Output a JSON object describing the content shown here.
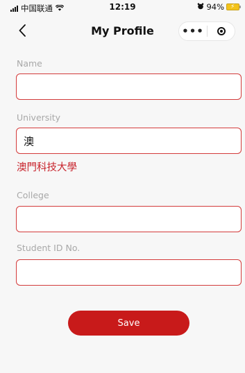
{
  "status_bar": {
    "carrier": "中国联通",
    "time": "12:19",
    "battery": "94%"
  },
  "nav": {
    "title": "My Profile",
    "more": "•••"
  },
  "form": {
    "name": {
      "label": "Name",
      "value": ""
    },
    "university": {
      "label": "University",
      "value": "澳",
      "suggestion": "澳門科技大學"
    },
    "college": {
      "label": "College",
      "value": ""
    },
    "student_id": {
      "label": "Student ID No.",
      "value": ""
    }
  },
  "save_label": "Save",
  "colors": {
    "accent": "#c81a1a",
    "field_border": "#d33a3a",
    "suggestion": "#c8242d",
    "label": "#a8a8a8"
  }
}
